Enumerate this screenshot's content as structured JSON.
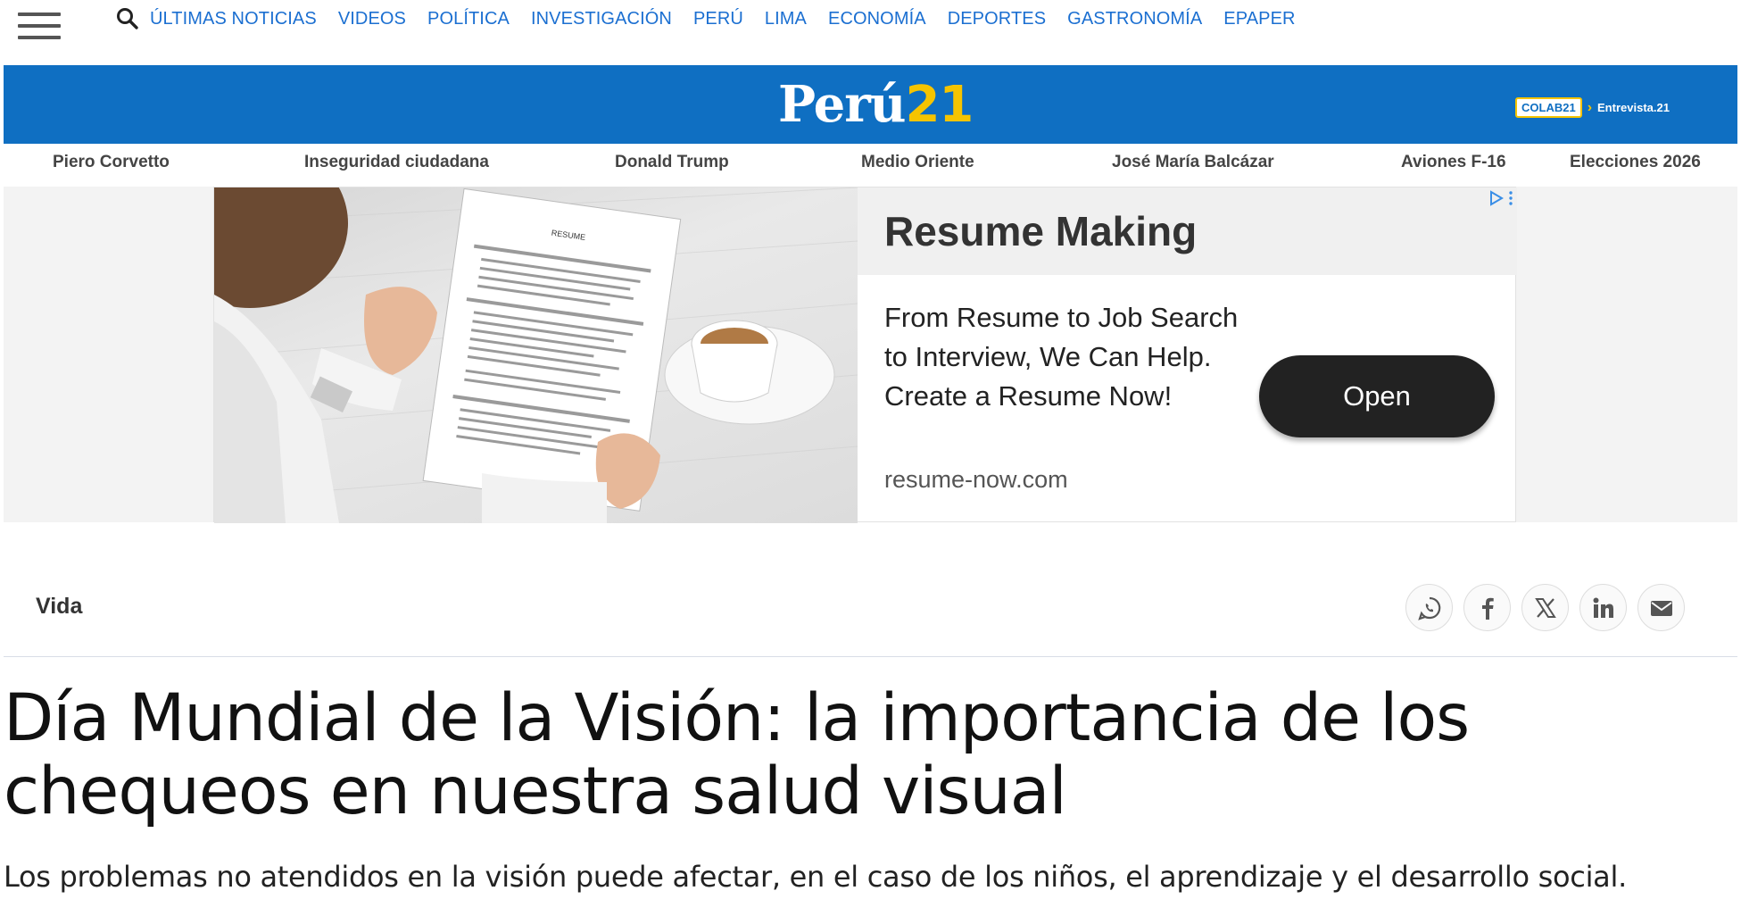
{
  "nav": {
    "links": [
      "ÚLTIMAS NOTICIAS",
      "VIDEOS",
      "POLÍTICA",
      "INVESTIGACIÓN",
      "PERÚ",
      "LIMA",
      "ECONOMÍA",
      "DEPORTES",
      "GASTRONOMÍA",
      "EPAPER"
    ]
  },
  "brand": {
    "logo_word": "Perú",
    "logo_number": "21",
    "colab_badge": "COLAB21",
    "colab_link": "Entrevista.21",
    "colors": {
      "bar": "#0f6fc2",
      "accent": "#f5c400"
    }
  },
  "trending": [
    "Piero Corvetto",
    "Inseguridad ciudadana",
    "Donald Trump",
    "Medio Oriente",
    "José María Balcázar",
    "Aviones F-16",
    "Elecciones 2026"
  ],
  "ad": {
    "title": "Resume Making",
    "text": "From Resume to Job Search to Interview, We Can Help. Create a Resume Now!",
    "domain": "resume-now.com",
    "button": "Open",
    "image_doc_title": "RESUME"
  },
  "article": {
    "section": "Vida",
    "share_icons": [
      "whatsapp-icon",
      "facebook-icon",
      "x-icon",
      "linkedin-icon",
      "email-icon"
    ],
    "headline": "Día Mundial de la Visión: la importancia de los chequeos en nuestra salud visual",
    "subhead": "Los problemas no atendidos en la visión puede afectar, en el caso de los niños, el aprendizaje y el desarrollo social."
  }
}
